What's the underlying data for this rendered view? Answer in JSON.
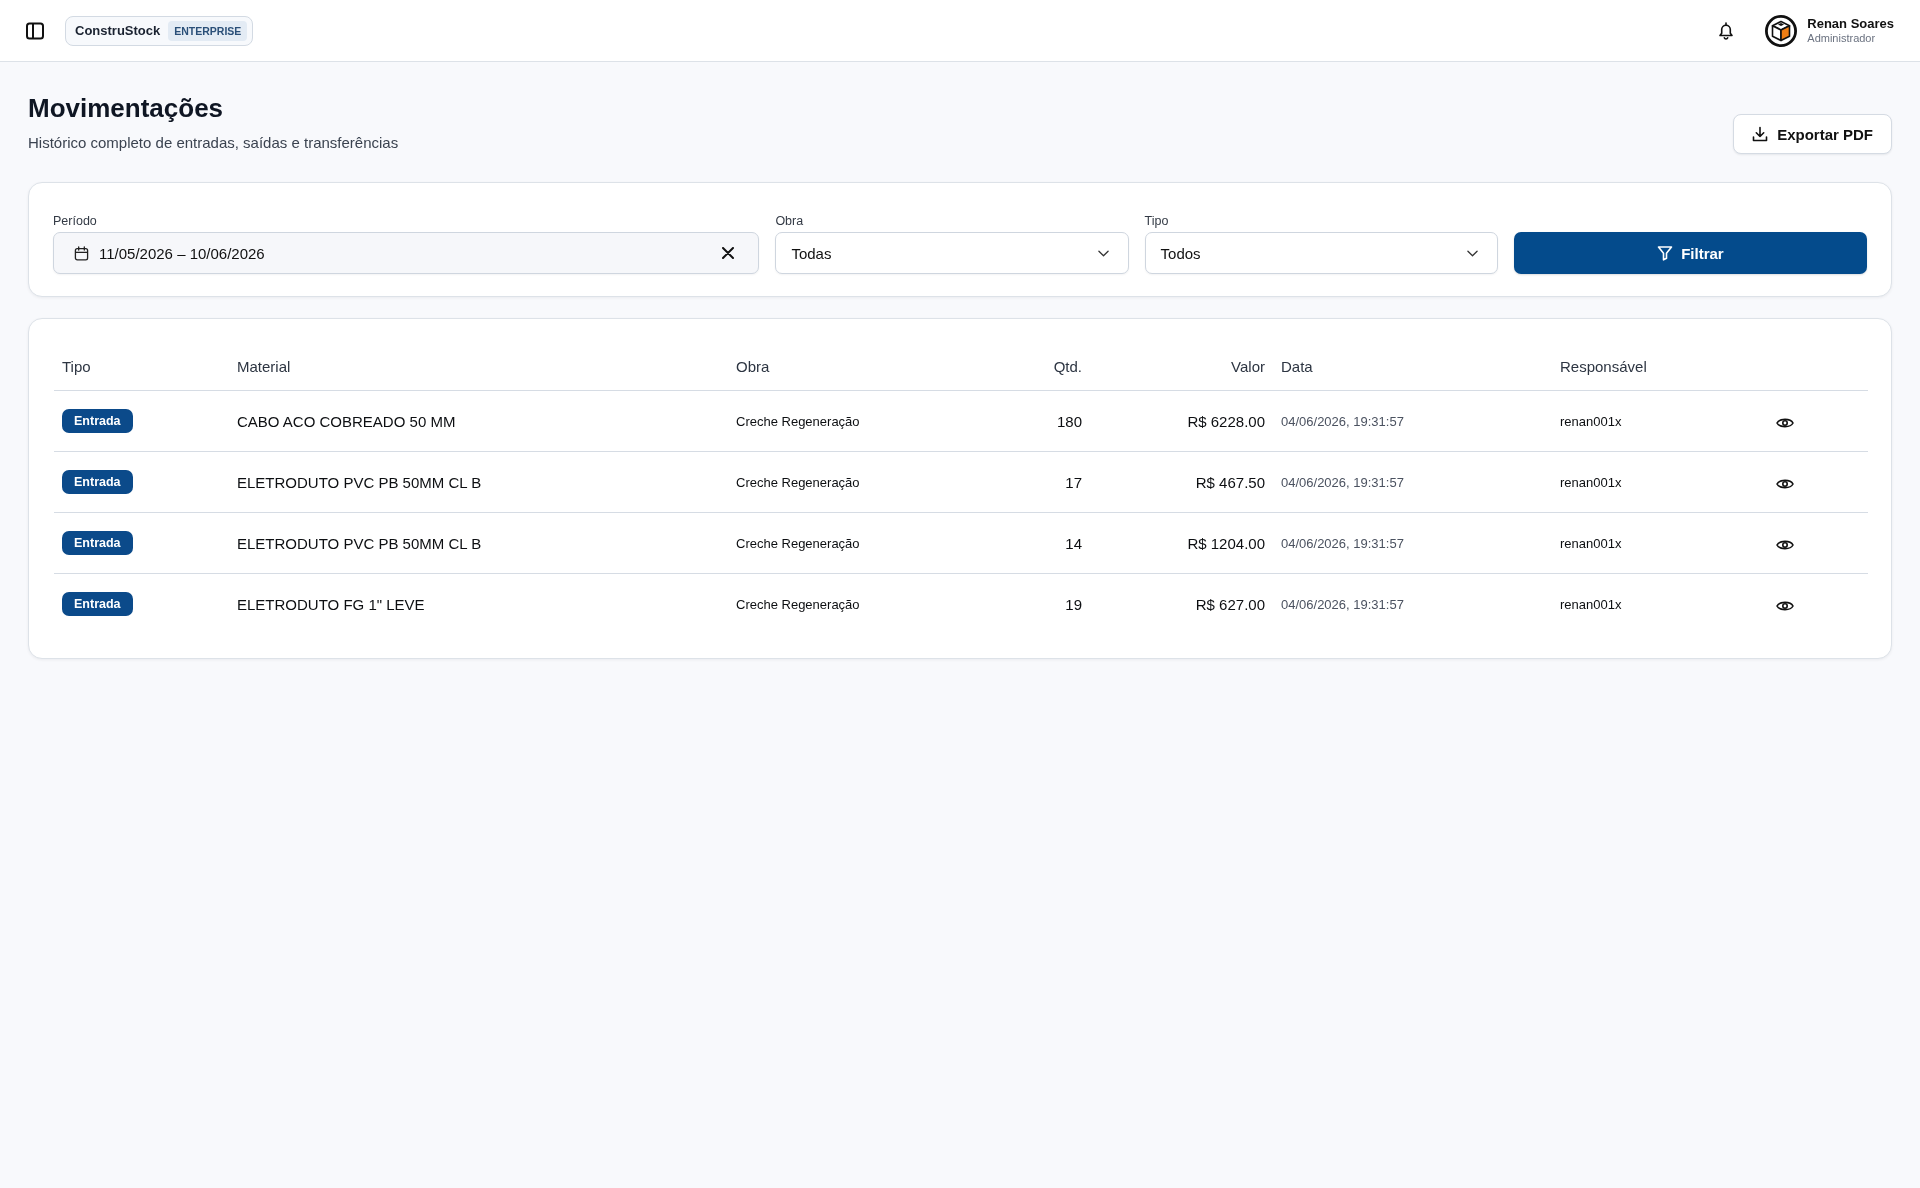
{
  "topbar": {
    "brand": {
      "name": "ConstruStock",
      "edition": "ENTERPRISE"
    },
    "user": {
      "name": "Renan Soares",
      "role": "Administrador"
    }
  },
  "header": {
    "title": "Movimentações",
    "subtitle": "Histórico completo de entradas, saídas e transferências",
    "export_button": "Exportar PDF"
  },
  "filters": {
    "fields": [
      {
        "kind": "daterange",
        "label": "Período",
        "value": "11/05/2026 – 10/06/2026"
      },
      {
        "kind": "select",
        "label": "Obra",
        "value": "Todas"
      },
      {
        "kind": "select",
        "label": "Tipo",
        "value": "Todos"
      }
    ],
    "submit": "Filtrar"
  },
  "table": {
    "columns": [
      {
        "label": "Tipo",
        "kind": "text"
      },
      {
        "label": "Material",
        "kind": "text"
      },
      {
        "label": "Obra",
        "kind": "text"
      },
      {
        "label": "Qtd.",
        "kind": "number"
      },
      {
        "label": "Valor",
        "kind": "number"
      },
      {
        "label": "Data",
        "kind": "text"
      },
      {
        "label": "Responsável",
        "kind": "text"
      }
    ],
    "rows": [
      {
        "tipo": "Entrada",
        "material": "CABO ACO COBREADO 50 MM",
        "obra": "Creche Regeneração",
        "qtd": "180",
        "valor": "R$ 6228.00",
        "data": "04/06/2026, 19:31:57",
        "responsavel": "renan001x"
      },
      {
        "tipo": "Entrada",
        "material": "ELETRODUTO PVC PB 50MM CL B",
        "obra": "Creche Regeneração",
        "qtd": "17",
        "valor": "R$ 467.50",
        "data": "04/06/2026, 19:31:57",
        "responsavel": "renan001x"
      },
      {
        "tipo": "Entrada",
        "material": "ELETRODUTO PVC PB 50MM CL B",
        "obra": "Creche Regeneração",
        "qtd": "14",
        "valor": "R$ 1204.00",
        "data": "04/06/2026, 19:31:57",
        "responsavel": "renan001x"
      },
      {
        "tipo": "Entrada",
        "material": "ELETRODUTO FG 1\" LEVE",
        "obra": "Creche Regeneração",
        "qtd": "19",
        "valor": "R$ 627.00",
        "data": "04/06/2026, 19:31:57",
        "responsavel": "renan001x"
      }
    ]
  }
}
